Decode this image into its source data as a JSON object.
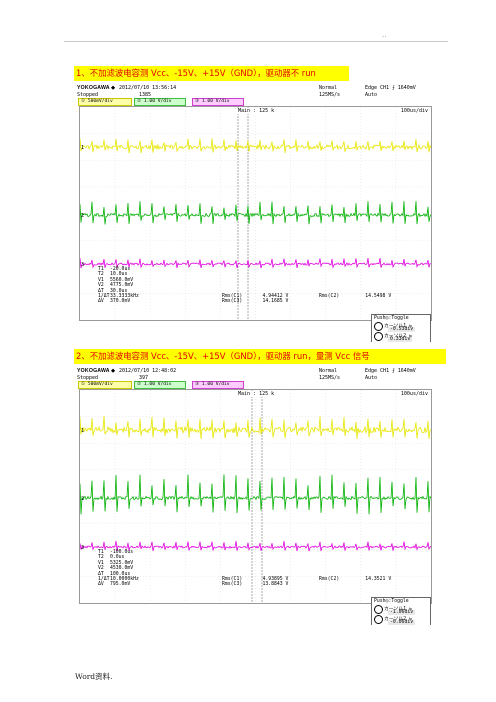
{
  "page": {
    "header_mark": "..",
    "footer": "Word资料."
  },
  "captions": [
    "1、不加滤波电容测 Vcc、-15V、+15V（GND），驱动器不 run",
    "2、不加滤波电容测 Vcc、-15V、+15V（GND），驱动器 run，量测 Vcc 信号"
  ],
  "scopes": [
    {
      "brand": "YOKOGAWA ◆",
      "state": "Stopped",
      "timestamp": "2012/07/10 13:56:14",
      "count": "1385",
      "mode": "Normal",
      "rate": "125MS/s",
      "trigger": "Edge CH1 ⨍ 1640mV",
      "trigger_mode": "Auto",
      "main": "Main : 125 k",
      "time_div": "100us/div",
      "ch1": "500mV/div",
      "ch2": "1.00 V/div",
      "ch3": "1.00 V/div",
      "meas_keys": [
        "T1",
        "T2",
        "V1",
        "V2",
        "ΔT",
        "1/ΔT",
        "ΔV"
      ],
      "meas_vals": [
        "-20.0us",
        "10.0us",
        "5560.0mV",
        "4775.0mV",
        "30.0us",
        "33.3333kHz",
        "370.0mV"
      ],
      "rms_keys": [
        "Rms(C1)",
        "Rms(C3)",
        "Rms(C2)"
      ],
      "rms_vals": [
        "4.94412 V",
        "14.1685 V",
        "14.5498 V"
      ],
      "push": "Push◎:Toggle",
      "cursor1_label": "カーソル1 ⇆",
      "cursor1_val": "-0.53div",
      "cursor2_label": "カーソル2 ⇆",
      "cursor2_val": "0.33div"
    },
    {
      "brand": "YOKOGAWA ◆",
      "state": "Stopped",
      "timestamp": "2012/07/10 12:48:02",
      "count": "397",
      "mode": "Normal",
      "rate": "125MS/s",
      "trigger": "Edge CH1 ⨍ 1640mV",
      "trigger_mode": "Auto",
      "main": "Main : 125 k",
      "time_div": "100us/div",
      "ch1": "500mV/div",
      "ch2": "1.00 V/div",
      "ch3": "1.00 V/div",
      "meas_keys": [
        "T1",
        "T2",
        "V1",
        "V2",
        "ΔT",
        "1/ΔT",
        "ΔV"
      ],
      "meas_vals": [
        "-100.0us",
        "0.0us",
        "5325.0mV",
        "4530.0mV",
        "100.0us",
        "10.0000kHz",
        "795.0mV"
      ],
      "rms_keys": [
        "Rms(C1)",
        "Rms(C3)",
        "Rms(C2)"
      ],
      "rms_vals": [
        "4.93895 V",
        "13.8843 V",
        "14.3521 V"
      ],
      "push": "Push◎:Toggle",
      "cursor1_label": "カーソル1 ⇆",
      "cursor1_val": "-1.06div",
      "cursor2_label": "カーソル2 ⇆",
      "cursor2_val": "-0.06div"
    }
  ],
  "colors": {
    "ch1": "#e6e600",
    "ch2": "#00b000",
    "ch3": "#e000e0",
    "caption_bg": "#ffff00",
    "caption_text": "#e00000"
  }
}
